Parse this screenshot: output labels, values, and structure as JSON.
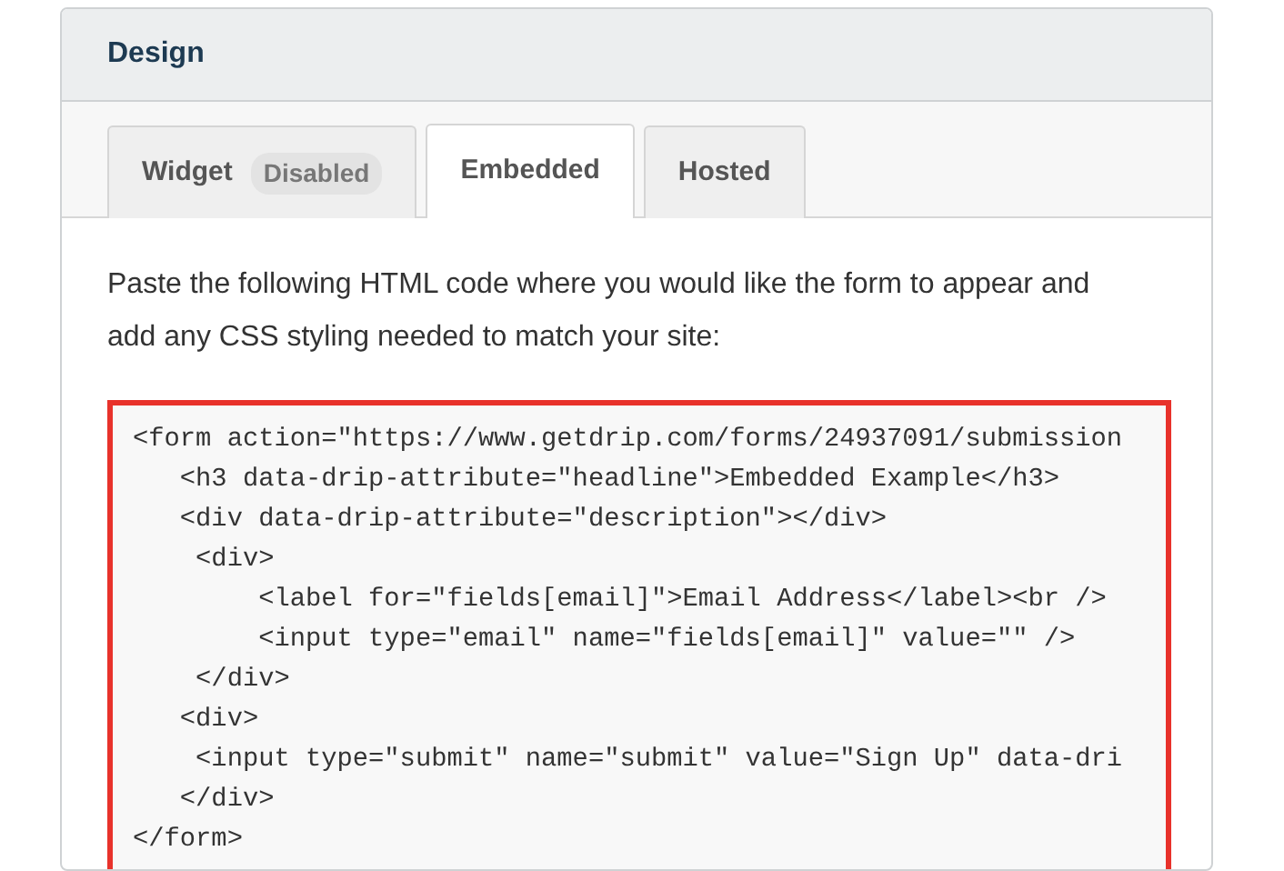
{
  "panel": {
    "title": "Design"
  },
  "tabs": [
    {
      "label": "Widget",
      "badge": "Disabled",
      "selected": false
    },
    {
      "label": "Embedded",
      "selected": true
    },
    {
      "label": "Hosted",
      "selected": false
    }
  ],
  "instructions": "Paste the following HTML code where you would like the form to appear and add any CSS styling needed to match your site:",
  "code_lines": [
    "<form action=\"https://www.getdrip.com/forms/24937091/submission",
    "   <h3 data-drip-attribute=\"headline\">Embedded Example</h3>",
    "   <div data-drip-attribute=\"description\"></div>",
    "    <div>",
    "        <label for=\"fields[email]\">Email Address</label><br />",
    "        <input type=\"email\" name=\"fields[email]\" value=\"\" />",
    "    </div>",
    "   <div>",
    "    <input type=\"submit\" name=\"submit\" value=\"Sign Up\" data-dri",
    "   </div>",
    "</form>"
  ]
}
